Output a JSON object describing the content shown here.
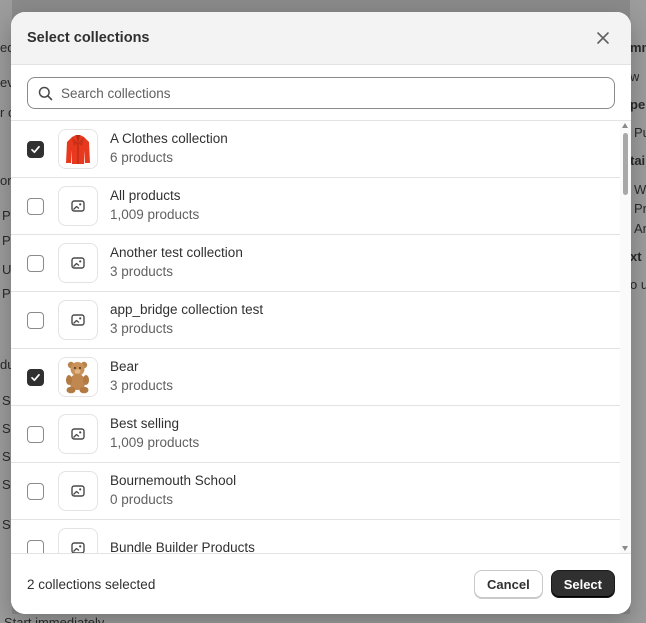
{
  "background": {
    "left_fragments": [
      "ed",
      "ev",
      "r c",
      "on",
      "P",
      "P",
      "U",
      "P",
      "du",
      "S",
      "S",
      "S",
      "S",
      "S"
    ],
    "right_fragments": [
      "mm",
      "w",
      "pe",
      "Pu",
      "tai",
      "W",
      "Pr",
      "Ar",
      "xt",
      "o up"
    ],
    "bottom_text": "Start immediately"
  },
  "modal": {
    "title": "Select collections",
    "close_icon": "close-icon"
  },
  "search": {
    "placeholder": "Search collections",
    "value": ""
  },
  "collections": [
    {
      "title": "A Clothes collection",
      "count": "6 products",
      "checked": true,
      "thumb": "red-jacket"
    },
    {
      "title": "All products",
      "count": "1,009 products",
      "checked": false,
      "thumb": "placeholder"
    },
    {
      "title": "Another test collection",
      "count": "3 products",
      "checked": false,
      "thumb": "placeholder"
    },
    {
      "title": "app_bridge collection test",
      "count": "3 products",
      "checked": false,
      "thumb": "placeholder"
    },
    {
      "title": "Bear",
      "count": "3 products",
      "checked": true,
      "thumb": "teddy-bear"
    },
    {
      "title": "Best selling",
      "count": "1,009 products",
      "checked": false,
      "thumb": "placeholder"
    },
    {
      "title": "Bournemouth School",
      "count": "0 products",
      "checked": false,
      "thumb": "placeholder"
    },
    {
      "title": "Bundle Builder Products",
      "count": "",
      "checked": false,
      "thumb": "placeholder"
    }
  ],
  "footer": {
    "status": "2 collections selected",
    "cancel_label": "Cancel",
    "select_label": "Select"
  }
}
